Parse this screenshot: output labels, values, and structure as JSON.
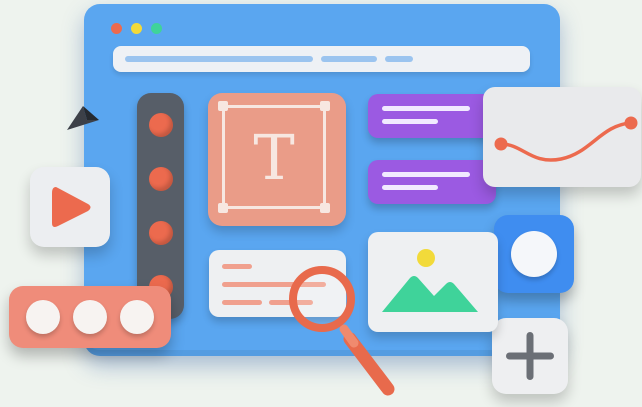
{
  "colors": {
    "window": "#5aa6f0",
    "accent_coral": "#ec6a4e",
    "purple": "#9b5ae2",
    "green": "#3fd39a",
    "yellow": "#f2da3a",
    "blue": "#3f8df0"
  },
  "icons": {
    "text_tool": "T",
    "cursor": "cursor-arrow-icon",
    "play": "play-icon",
    "plus": "plus-icon",
    "image": "image-landscape-icon",
    "search": "magnifier-icon",
    "graph": "curve-graph-icon"
  }
}
